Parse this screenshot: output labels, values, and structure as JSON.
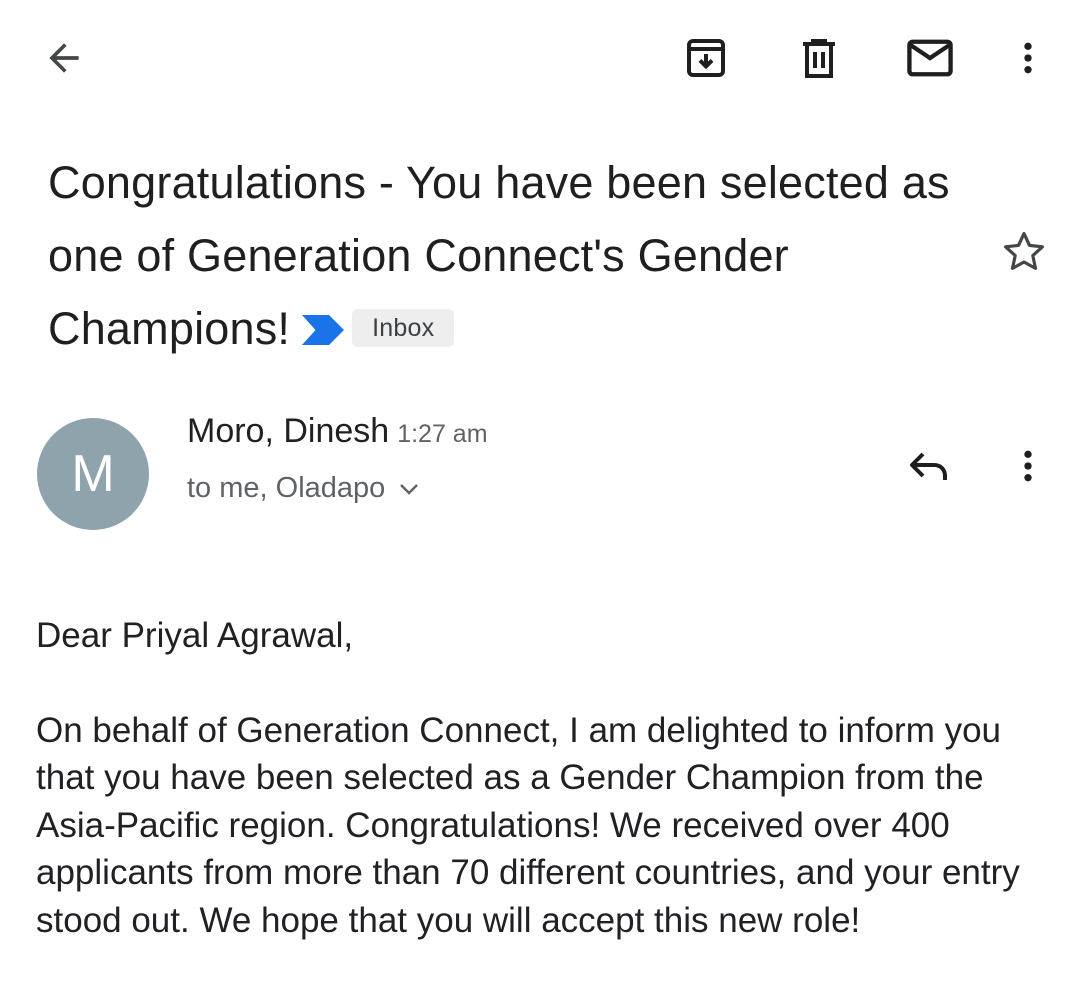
{
  "toolbar": {
    "back_icon": "arrow-left-icon",
    "archive_icon": "archive-icon",
    "delete_icon": "trash-icon",
    "mark_unread_icon": "mail-icon",
    "more_icon": "more-vertical-icon"
  },
  "email": {
    "subject": "Congratulations - You have been selected as one of Generation Connect's Gender Champions!",
    "important_marker_color": "#1a73e8",
    "label": "Inbox",
    "starred": false,
    "sender": {
      "avatar_initial": "M",
      "avatar_color": "#8fa3ad",
      "name": "Moro, Dinesh",
      "time": "1:27 am",
      "recipients": "to me, Oladapo"
    },
    "body": {
      "greeting": "Dear Priyal Agrawal,",
      "paragraph": "On behalf of Generation Connect, I am delighted to inform you that you have been selected as a Gender Champion from the Asia-Pacific region. Congratulations! We received over 400 applicants from more than 70 different countries, and your entry stood out. We hope that you will accept this new role!"
    }
  }
}
